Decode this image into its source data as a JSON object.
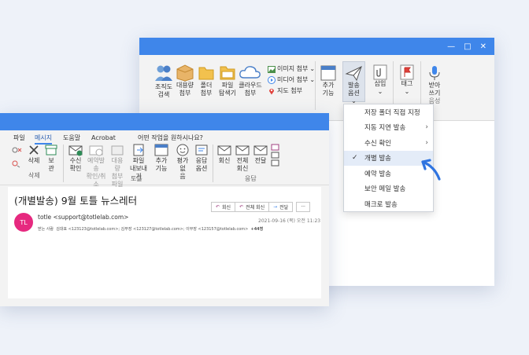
{
  "back_window": {
    "controls": {
      "minimize": "—",
      "maximize": "□",
      "close": "✕"
    },
    "ribbon": {
      "org_search": "조직도\n검색",
      "large_attach": "대용량\n첨부",
      "folder_attach": "폴더\n첨부",
      "file_explorer": "파일\n탐색기",
      "cloud_attach": "클라우드\n첨부",
      "image_attach": "이미지 첨부",
      "media_attach": "미디어 첨부",
      "map_attach": "지도 첨부",
      "more_features": "추가\n기능",
      "send_options": "발송\n옵션",
      "insert": "삽입",
      "tag": "태그",
      "dictate": "받아\n쓰기",
      "voice_group": "음성"
    },
    "menu_items": [
      {
        "label": "저장 폴더 직접 지정",
        "submenu": false,
        "checked": false
      },
      {
        "label": "지동 지연 발송",
        "submenu": true,
        "checked": false
      },
      {
        "label": "수신 확인",
        "submenu": true,
        "checked": false
      },
      {
        "label": "개별 발송",
        "submenu": false,
        "checked": true
      },
      {
        "label": "예약 발송",
        "submenu": false,
        "checked": false
      },
      {
        "label": "보안 메일 발송",
        "submenu": false,
        "checked": false
      },
      {
        "label": "매크로 발송",
        "submenu": false,
        "checked": false
      }
    ],
    "checkmark": "✓",
    "chevron": "›"
  },
  "front_window": {
    "tabs": [
      "파일",
      "메시지",
      "도움말",
      "Acrobat"
    ],
    "active_tab": "메시지",
    "search_hint": "어떤 작업을 원하시나요?",
    "ribbon": {
      "delete": "삭제",
      "archive": "보\n관",
      "delete_group": "삭제",
      "read_receipt": "수신\n확인",
      "reserve_cancel": "예약발송\n확인/취소",
      "large_attach": "대용량\n첨부파일",
      "file_export": "파일\n내보내기",
      "more_features": "추가\n기능",
      "rate": "평가 없\n음",
      "reply_options": "응답\n옵션",
      "totle_group": "토틀",
      "reply": "회신",
      "reply_all": "전체\n회신",
      "forward": "전달",
      "respond_group": "응답"
    },
    "email": {
      "subject": "(개별발송) 9월 토틀 뉴스레터",
      "avatar": "TL",
      "sender": "totle <support@totlelab.com>",
      "date": "2021-09-16 (목) 오전 11:23",
      "recipients_label": "받는 사람",
      "recipients": "김대표 <123123@totlelab.com>; 김부장 <123127@totlelab.com>; 이부장 <123157@totlelab.com>",
      "more_count": "+44명",
      "reply_btn": "회신",
      "reply_all_btn": "전체 회신",
      "forward_btn": "전달",
      "more_btn": "···"
    }
  },
  "colors": {
    "accent": "#3f86ea",
    "avatar": "#e6297f",
    "arrow": "#2f74e0",
    "ribbon_bg": "#f3f3f3"
  }
}
